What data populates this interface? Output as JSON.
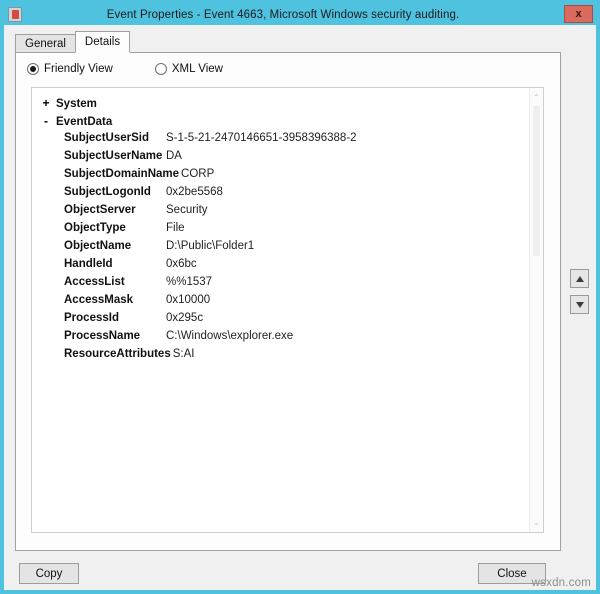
{
  "window": {
    "title": "Event Properties - Event 4663, Microsoft Windows security auditing.",
    "icon": "event-properties-icon",
    "close_label": "x"
  },
  "tabs": [
    {
      "label": "General",
      "active": false
    },
    {
      "label": "Details",
      "active": true
    }
  ],
  "view_modes": [
    {
      "label": "Friendly View",
      "checked": true
    },
    {
      "label": "XML View",
      "checked": false
    }
  ],
  "tree": [
    {
      "expander": "+",
      "label": "System"
    },
    {
      "expander": "-",
      "label": "EventData"
    }
  ],
  "event_data": [
    {
      "name": "SubjectUserSid",
      "value": "S-1-5-21-2470146651-3958396388-2"
    },
    {
      "name": "SubjectUserName",
      "value": "DA"
    },
    {
      "name": "SubjectDomainName",
      "value": "CORP"
    },
    {
      "name": "SubjectLogonId",
      "value": "0x2be5568"
    },
    {
      "name": "ObjectServer",
      "value": "Security"
    },
    {
      "name": "ObjectType",
      "value": "File"
    },
    {
      "name": "ObjectName",
      "value": "D:\\Public\\Folder1"
    },
    {
      "name": "HandleId",
      "value": "0x6bc"
    },
    {
      "name": "AccessList",
      "value": "%%1537"
    },
    {
      "name": "AccessMask",
      "value": "0x10000"
    },
    {
      "name": "ProcessId",
      "value": "0x295c"
    },
    {
      "name": "ProcessName",
      "value": "C:\\Windows\\explorer.exe"
    },
    {
      "name": "ResourceAttributes",
      "value": "S:AI"
    }
  ],
  "scrollbar": {
    "up_glyph": "⌃",
    "down_glyph": "⌄"
  },
  "nav": {
    "up_name": "previous-event-button",
    "down_name": "next-event-button"
  },
  "buttons": {
    "copy": "Copy",
    "close": "Close"
  },
  "watermark": "wsxdn.com",
  "colors": {
    "titlebar": "#4fc2e0",
    "close_button": "#d96a5e",
    "dialog_bg": "#f0f0f0",
    "content_bg": "#ffffff"
  }
}
